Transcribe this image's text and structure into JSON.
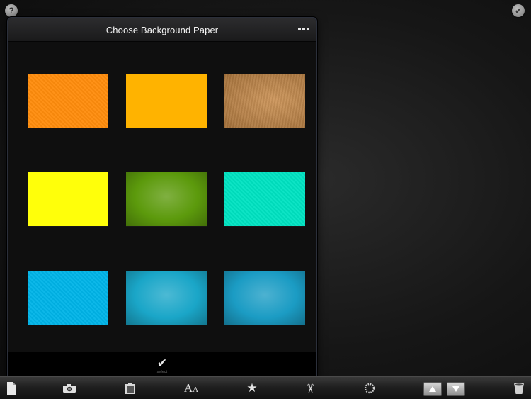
{
  "popover": {
    "title": "Choose Background Paper",
    "footer_label": "select"
  },
  "papers": [
    {
      "name": "orange-paper",
      "color": "#ff8c0c",
      "texture": "diag"
    },
    {
      "name": "amber-paper",
      "color": "#ffb300",
      "texture": "flat"
    },
    {
      "name": "kraft-paper",
      "color": "#c78947",
      "texture": "grain"
    },
    {
      "name": "yellow-paper",
      "color": "#ffff0a",
      "texture": "flat"
    },
    {
      "name": "green-paper",
      "color": "#5c9a0c",
      "texture": "radial"
    },
    {
      "name": "turquoise-paper",
      "color": "#00e3c2",
      "texture": "diag"
    },
    {
      "name": "sky-blue-paper",
      "color": "#00b4e8",
      "texture": "diag"
    },
    {
      "name": "teal-radial-paper",
      "color": "#1aa6c8",
      "texture": "radial"
    },
    {
      "name": "blue-radial-paper",
      "color": "#1b9cc4",
      "texture": "radial"
    }
  ],
  "icons": {
    "help": "question-icon",
    "done": "checkmark-icon",
    "more": "more-icon",
    "toolbar": [
      "paper-icon",
      "camera-icon",
      "clipboard-icon",
      "text-icon",
      "star-icon",
      "scissors-icon",
      "spinner-icon",
      "arrow-up-icon",
      "arrow-down-icon",
      "trash-icon"
    ]
  },
  "glyphs": {
    "help": "?",
    "done": "✔",
    "check": "✔",
    "text": "A",
    "text_small": "A",
    "star": "★",
    "scissors": "✂"
  }
}
